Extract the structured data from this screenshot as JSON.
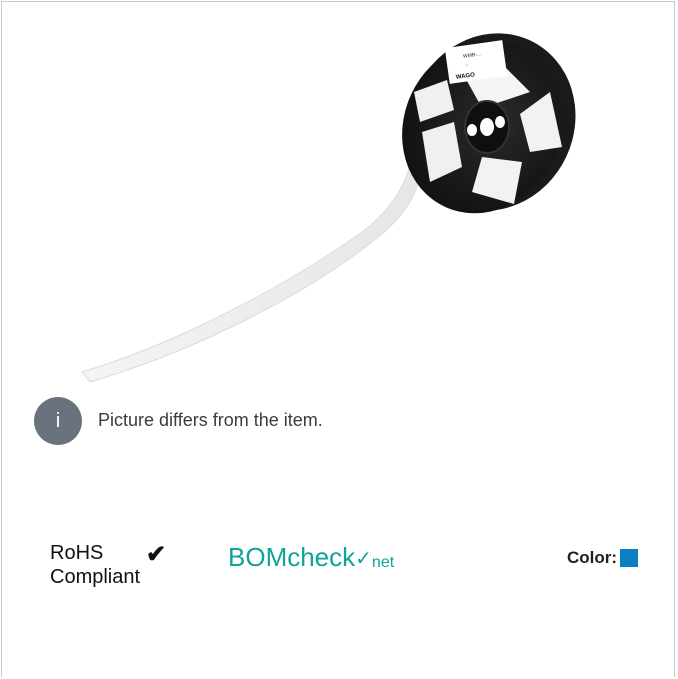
{
  "note": {
    "icon": "info-icon",
    "icon_text": "i",
    "text": "Picture differs from the item."
  },
  "certifications": {
    "rohs": {
      "label_line1": "RoHS",
      "label_line2": "Compliant",
      "icon": "checkmark-icon"
    },
    "bomcheck": {
      "brand": "BOMcheck",
      "suffix": "net",
      "color": "#10a39a"
    }
  },
  "color_info": {
    "label": "Color:",
    "swatch_color": "#0a7fc2"
  },
  "product_image": {
    "reel_label_lines": [
      "WMB-...",
      "...",
      "WAGO"
    ]
  }
}
